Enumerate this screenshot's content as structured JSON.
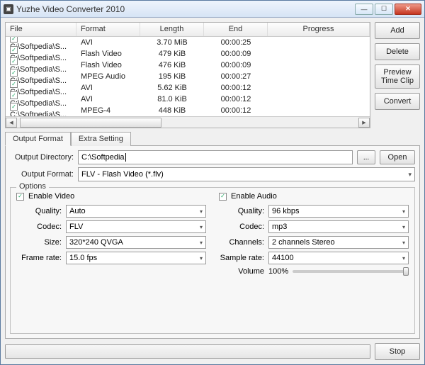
{
  "window": {
    "title": "Yuzhe Video Converter 2010"
  },
  "filelist": {
    "headers": {
      "file": "File",
      "format": "Format",
      "length": "Length",
      "end": "End",
      "progress": "Progress"
    },
    "rows": [
      {
        "checked": true,
        "file": "C:\\Softpedia\\S...",
        "format": "AVI",
        "length": "3.70 MiB",
        "end": "00:00:25"
      },
      {
        "checked": true,
        "file": "C:\\Softpedia\\S...",
        "format": "Flash Video",
        "length": "479 KiB",
        "end": "00:00:09"
      },
      {
        "checked": true,
        "file": "C:\\Softpedia\\S...",
        "format": "Flash Video",
        "length": "476 KiB",
        "end": "00:00:09"
      },
      {
        "checked": true,
        "file": "C:\\Softpedia\\S...",
        "format": "MPEG Audio",
        "length": "195 KiB",
        "end": "00:00:27"
      },
      {
        "checked": true,
        "file": "C:\\Softpedia\\S...",
        "format": "AVI",
        "length": "5.62 KiB",
        "end": "00:00:12"
      },
      {
        "checked": true,
        "file": "C:\\Softpedia\\S...",
        "format": "AVI",
        "length": "81.0 KiB",
        "end": "00:00:12"
      },
      {
        "checked": true,
        "file": "C:\\Softpedia\\S...",
        "format": "MPEG-4",
        "length": "448 KiB",
        "end": "00:00:12"
      }
    ]
  },
  "side": {
    "add": "Add",
    "delete": "Delete",
    "preview": "Preview\nTime Clip",
    "convert": "Convert"
  },
  "tabs": {
    "output": "Output Format",
    "extra": "Extra Setting"
  },
  "output": {
    "dir_label": "Output Directory:",
    "dir_value": "C:\\Softpedia",
    "browse": "...",
    "open": "Open",
    "format_label": "Output Format:",
    "format_value": "FLV - Flash Video (*.flv)"
  },
  "options": {
    "title": "Options",
    "enable_video": "Enable Video",
    "enable_audio": "Enable Audio",
    "video": {
      "quality_lbl": "Quality:",
      "quality_val": "Auto",
      "codec_lbl": "Codec:",
      "codec_val": "FLV",
      "size_lbl": "Size:",
      "size_val": "320*240 QVGA",
      "frate_lbl": "Frame rate:",
      "frate_val": "15.0 fps"
    },
    "audio": {
      "quality_lbl": "Quality:",
      "quality_val": "96 kbps",
      "codec_lbl": "Codec:",
      "codec_val": "mp3",
      "channels_lbl": "Channels:",
      "channels_val": "2 channels Stereo",
      "srate_lbl": "Sample rate:",
      "srate_val": "44100",
      "volume_lbl": "Volume",
      "volume_val": "100%"
    }
  },
  "bottom": {
    "stop": "Stop"
  }
}
